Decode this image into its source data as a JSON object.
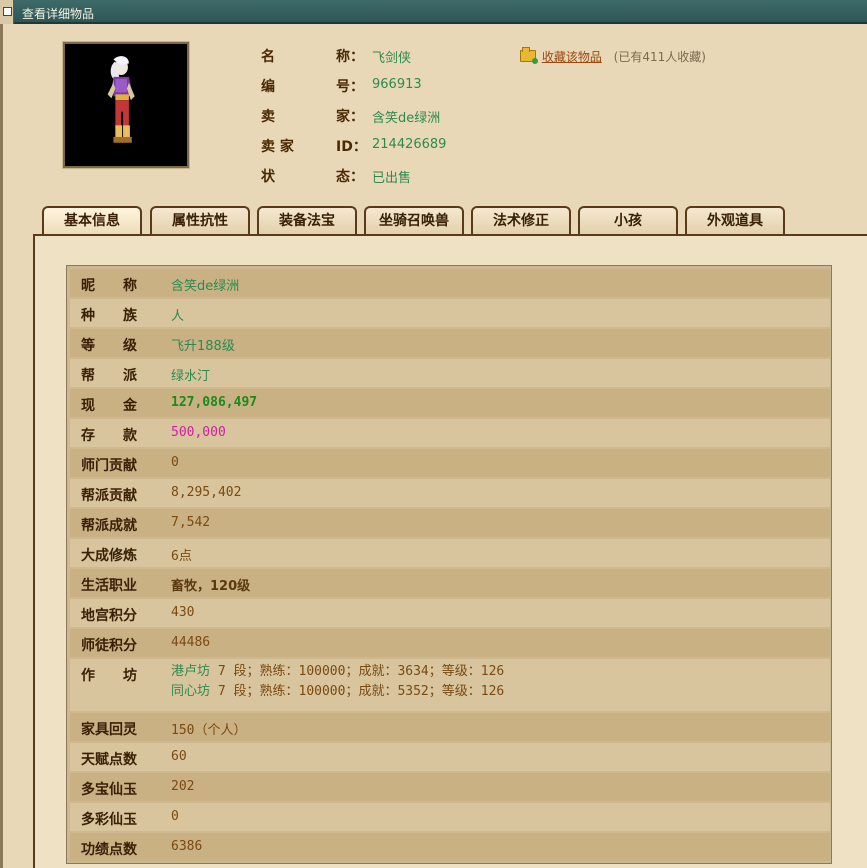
{
  "window": {
    "title": "查看详细物品"
  },
  "info": {
    "name": {
      "label": "名",
      "label2": "称",
      "colon": "：",
      "value": "飞剑侠"
    },
    "number": {
      "label": "编",
      "label2": "号",
      "colon": "：",
      "value": "966913"
    },
    "seller": {
      "label": "卖",
      "label2": "家",
      "colon": "：",
      "value": "含笑de绿洲"
    },
    "seller_id": {
      "label": "卖 家",
      "label2": "ID",
      "colon": "：",
      "value": "214426689"
    },
    "status": {
      "label": "状",
      "label2": "态",
      "colon": "：",
      "value": "已出售"
    }
  },
  "favorite": {
    "link": "收藏该物品",
    "count": "(已有411人收藏)",
    "icon": "folder-add-icon"
  },
  "tabs": [
    {
      "label": "基本信息"
    },
    {
      "label": "属性抗性"
    },
    {
      "label": "装备法宝"
    },
    {
      "label": "坐骑召唤兽"
    },
    {
      "label": "法术修正"
    },
    {
      "label": "小孩"
    },
    {
      "label": "外观道具"
    }
  ],
  "rows": [
    {
      "label": "昵　　称",
      "value": "含笑de绿洲"
    },
    {
      "label": "种　　族",
      "value": "人"
    },
    {
      "label": "等　　级",
      "value": "飞升188级"
    },
    {
      "label": "帮　　派",
      "value": "绿水汀"
    },
    {
      "label": "现　　金",
      "value": "127,086,497"
    },
    {
      "label": "存　　款",
      "value": "500,000"
    },
    {
      "label": "师门贡献",
      "value": "0"
    },
    {
      "label": "帮派贡献",
      "value": "8,295,402"
    },
    {
      "label": "帮派成就",
      "value": "7,542"
    },
    {
      "label": "大成修炼",
      "value": "6点"
    },
    {
      "label": "生活职业",
      "value": "畜牧，120级"
    },
    {
      "label": "地宫积分",
      "value": "430"
    },
    {
      "label": "师徒积分",
      "value": "44486"
    },
    {
      "label": "作　　坊",
      "lines": [
        {
          "name": "港卢坊",
          "rest": " 7 段；熟练：100000；成就：3634；等级：126"
        },
        {
          "name": "同心坊",
          "rest": " 7 段；熟练：100000；成就：5352；等级：126"
        }
      ]
    },
    {
      "label": "家具回灵",
      "value": "150（个人）"
    },
    {
      "label": "天赋点数",
      "value": "60"
    },
    {
      "label": "多宝仙玉",
      "value": "202"
    },
    {
      "label": "多彩仙玉",
      "value": "0"
    },
    {
      "label": "功绩点数",
      "value": "6386"
    }
  ]
}
